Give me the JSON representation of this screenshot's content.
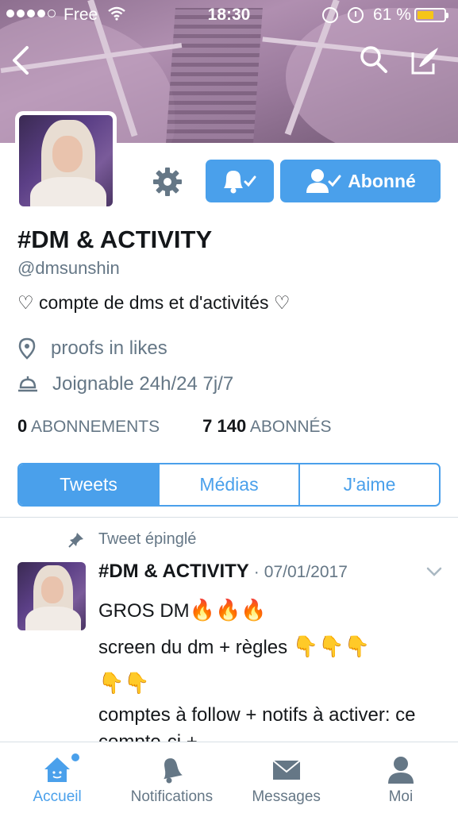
{
  "status_bar": {
    "carrier": "Free",
    "time": "18:30",
    "battery_percent": "61 %",
    "battery_level": 0.61,
    "icons": [
      "signal-dots-icon",
      "wifi-icon",
      "orientation-lock-icon",
      "alarm-icon",
      "battery-icon"
    ]
  },
  "nav": {
    "icons": [
      "back-arrow-icon",
      "search-icon",
      "compose-tweet-icon"
    ]
  },
  "profile": {
    "name": "#DM & ACTIVITY",
    "handle": "@dmsunshin",
    "bio": "♡ compte de dms et d'activités ♡",
    "location": "proofs in likes",
    "contact": "Joignable 24h/24 7j/7",
    "following_count": "0",
    "following_label": "ABONNEMENTS",
    "followers_count": "7 140",
    "followers_label": "ABONNÉS"
  },
  "actions": {
    "follow_label": "Abonné",
    "icons": [
      "gear-icon",
      "bell-check-icon",
      "user-check-icon"
    ]
  },
  "tabs": [
    {
      "label": "Tweets",
      "active": true
    },
    {
      "label": "Médias",
      "active": false
    },
    {
      "label": "J'aime",
      "active": false
    }
  ],
  "tweet": {
    "pinned_label": "Tweet épinglé",
    "author": "#DM & ACTIVITY",
    "separator": "·",
    "date": "07/01/2017",
    "line1": "GROS DM",
    "line1_emoji": "🔥🔥🔥",
    "line2": "screen du dm + règles ",
    "line2_emoji": "👇👇👇",
    "line3_emoji": "👇👇",
    "line4": "comptes à follow + notifs à activer: ce compte-ci +"
  },
  "tabbar": [
    {
      "label": "Accueil",
      "icon": "home-icon",
      "active": true
    },
    {
      "label": "Notifications",
      "icon": "bell-icon",
      "active": false
    },
    {
      "label": "Messages",
      "icon": "envelope-icon",
      "active": false
    },
    {
      "label": "Moi",
      "icon": "person-icon",
      "active": false
    }
  ],
  "colors": {
    "accent": "#4aa0eb",
    "text": "#14171a",
    "muted": "#657786",
    "battery": "#f5c518"
  }
}
